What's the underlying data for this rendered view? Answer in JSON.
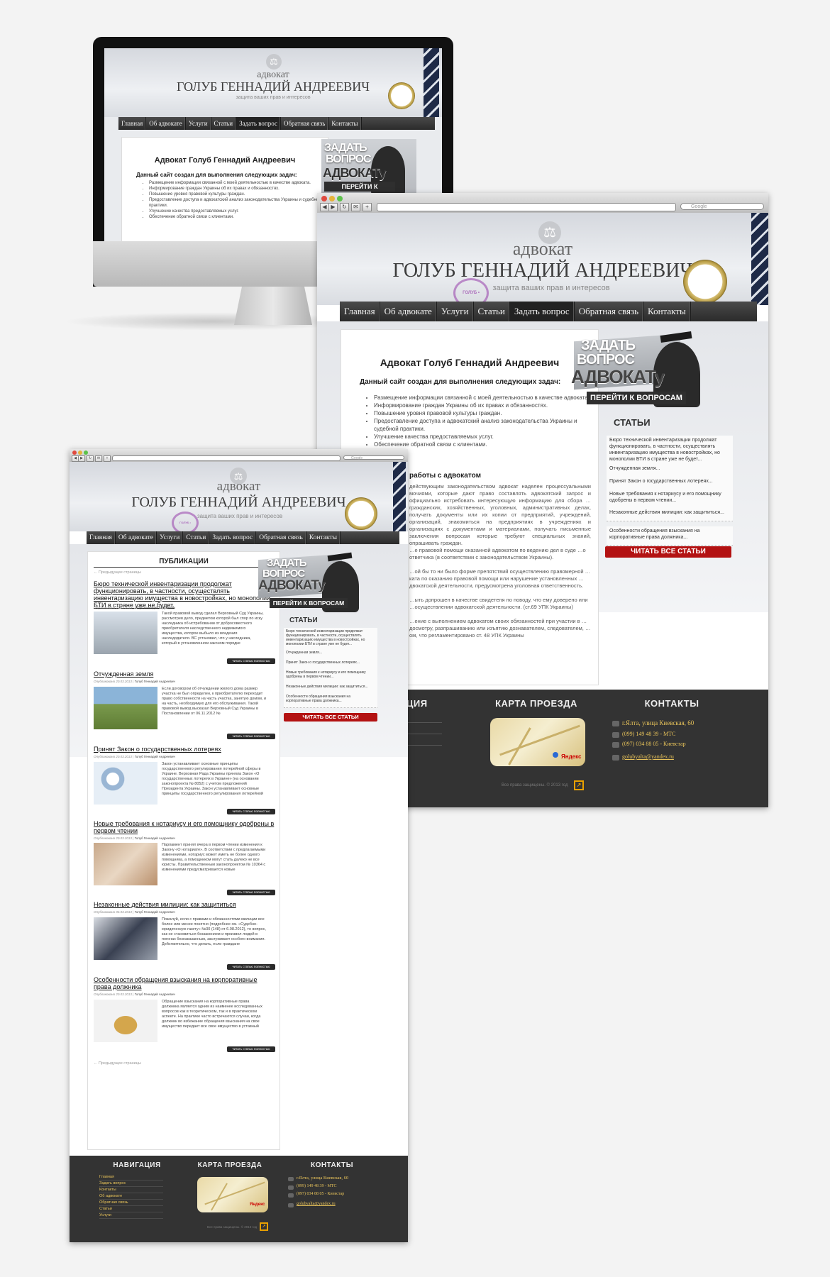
{
  "site": {
    "header_subtitle": "адвокат",
    "header_title": "ГОЛУБ ГЕННАДИЙ АНДРЕЕВИЧ",
    "header_slogan": "защита ваших прав и интересов",
    "stamp_text": "ГОЛУБ • АДВОКАТ"
  },
  "nav": {
    "items": [
      "Главная",
      "Об адвокате",
      "Услуги",
      "Статьи",
      "Задать вопрос",
      "Обратная связь",
      "Контакты"
    ]
  },
  "ask_banner": {
    "line1": "ЗАДАТЬ",
    "line2": "ВОПРОС",
    "line3": "АДВОКАТу",
    "button": "ПЕРЕЙТИ К ВОПРОСАМ"
  },
  "main": {
    "title": "Адвокат Голуб Геннадий Андреевич",
    "tasks_heading": "Данный сайт создан для выполнения следующих задач:",
    "tasks": [
      "Размещение информации связанной с моей деятельностью в качестве адвоката.",
      "Информирование граждан Украины об их правах и обязанностях.",
      "Повышение уровня правовой культуры граждан.",
      "Предоставление доступа и адвокатский анализ законодательства Украины и судебной практики.",
      "Улучшение качества предоставляемых услуг.",
      "Обеспечение обратной связи с клиентами."
    ],
    "section2_heading": "работы с адвокатом",
    "paragraphs": [
      "действующим законодательством адвокат наделен процессуальными мочиями, которые дают право составлять адвокатский запрос и официально истребовать интересующую информацию для сбора …гражданских, хозяйственных, уголовных, административных делах, получать документы или их копии от предприятий, учреждений, организаций, знакомиться на предприятиях в учреждениях и организациях с документами и материалами, получать письменные заключения вопросам которые требуют специальных знаний, опрашивать граждан.",
      "…е правовой помощи оказанной адвокатом по ведению дел в суде …о ответчика (в соответствии с законодательством Украины).",
      "…ой бы то ни было форме препятствий осуществлению правомерной …ката по оказанию правовой помощи или нарушение установленных …двокатской деятельности, предусмотрена уголовная ответственность.",
      "…ыть допрошен в качестве свидетеля по поводу, что ему доверено или …осуществлении адвокатской деятельности. (ст.69 УПК Украины)",
      "…ение с выполнением адвокатом своих обязанностей при участии в …досмотру, разпрашиванию или изъятию дознавателем, следователем, …ом, что регламентировано ст. 48 УПК Украины"
    ]
  },
  "sidebar": {
    "articles_title": "СТАТЬИ",
    "articles": [
      "Бюро технической инвентаризации продолжат функционировать, в частности, осуществлять инвентаризацию имущества в новостройках, но монополии БТИ в стране уже не будет...",
      "Отчужденная земля...",
      "Принят Закон о государственных лотереях...",
      "Новые требования к нотариусу и его помощнику одобрены в первом чтении...",
      "Незаконные действия милиции: как защититься...",
      "Особенности обращения взыскания на корпоративные права должника..."
    ],
    "read_all": "ЧИТАТЬ ВСЕ СТАТЬИ"
  },
  "footer": {
    "nav_title": "НАВИГАЦИЯ",
    "nav_title_partial": "АЦИЯ",
    "map_title": "КАРТА ПРОЕЗДА",
    "contacts_title": "КОНТАКТЫ",
    "address": "г.Ялта, улица Киевская, 60",
    "phone1": "(099) 149 48 39 - МТС",
    "phone2": "(097) 034 88 05 - Киевстар",
    "email": "golubyalta@yandex.ru",
    "copyright": "Все права защищены. © 2013 год",
    "map_brand": "Яндекс",
    "nav_items": [
      "Главная",
      "Задать вопрос",
      "Контакты",
      "Об адвокате",
      "Обратная связь",
      "Статьи",
      "Услуги"
    ]
  },
  "browser": {
    "search_placeholder": "Google"
  },
  "publications": {
    "title": "ПУБЛИКАЦИИ",
    "prev_top": "← Предыдущие страницы",
    "prev_bottom": "← Предыдущие страницы",
    "more_label": "читать статью полностью",
    "author": "Голуб Геннадий Андреевич",
    "items": [
      {
        "title": "Бюро технической инвентаризации продолжат функционировать, в частности, осуществлять инвентаризацию имущества в новостройках, но монополии БТИ в стране уже не будет.",
        "meta_prefix": "Опубликовано 20.03.2013 |",
        "body": "Такой правовой вывод сделал Верховный Суд Украины, рассмотрев дело, предметом которой был спор по иску наследника об истребовании от добросовестного приобретателя наследственного недвижимого имущества, которое выбыло из владения наследодателя. ВС установил, что у наследника, который в установленном законом порядке"
      },
      {
        "title": "Отчужденная земля",
        "meta_prefix": "Опубликовано 20.03.2013 |",
        "body": "Если договором об отчуждении жилого дома размер участка не был определен, к приобретателю переходит право собственности на часть участка, занятую домом, и на часть, необходимую для его обслуживания. Такой правовой вывод высказал Верховный Суд Украины в Постановлении от 06.11.2012 №"
      },
      {
        "title": "Принят Закон о государственных лотереях",
        "meta_prefix": "Опубликовано 20.03.2013 |",
        "body": "Закон устанавливает основные принципы государственного регулирования лотерейной сферы в Украине. Верховная Рада Украины приняла Закон «О государственных лотереях в Украине» (на основании законопроекта № 8052) с учетом предложений Президента Украины. Закон устанавливает основные принципы государственного регулирования лотерейной"
      },
      {
        "title": "Новые требования к нотариусу и его помощнику одобрены в первом чтении",
        "meta_prefix": "Опубликовано 20.03.2013 |",
        "body": "Парламент принял вчера в первом чтении изменения к Закону «О нотариате». В соответствии с предлагаемыми изменениями, нотариус может иметь не более одного помощника, а помощником могут стать далеко не все юристы. Правительственным законопроектом № 10364 с изменениями предусматривается новые"
      },
      {
        "title": "Незаконные действия милиции: как защититься",
        "meta_prefix": "Опубликовано 04.03.2013 |",
        "body": "Пожалуй, если с правами и обязанностями милиции все более или менее понятно (подробнее см. «Судебно-юридическую газету» №30 (148) от 6.08.2012), то вопрос, как не становиться беззаконием и произвол людей в погонах безнаказанным, заслуживает особого внимания. Действительно, что делать, если граждане"
      },
      {
        "title": "Особенности обращения взыскания на корпоративные права должника",
        "meta_prefix": "Опубликовано 20.03.2013 |",
        "body": "Обращение взыскания на корпоративные права должника является одним из наименее исследованных вопросов как в теоретическом, так и в практическом аспекте. На практике часто встречаются случаи, когда должник во избежание обращения взыскания на свое имущество передает все свое имущество в уставный"
      }
    ]
  },
  "colors": {
    "nav_bg": "#2f2f2f",
    "accent_red": "#b31212",
    "footer_bg": "#333333",
    "footer_link": "#e8c35a"
  }
}
